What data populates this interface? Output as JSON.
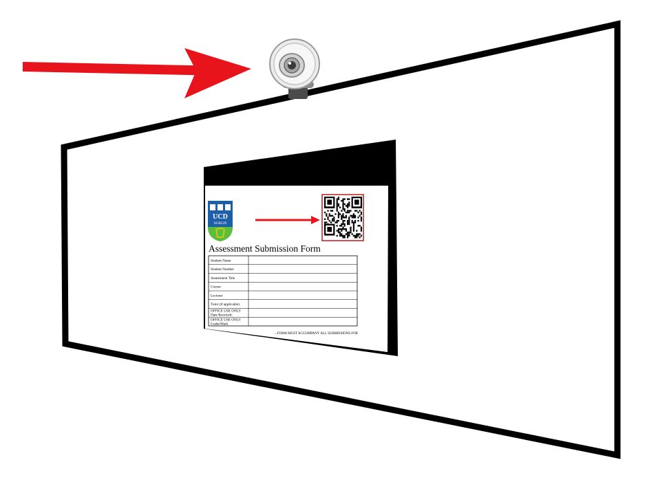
{
  "colors": {
    "arrow": "#e8141b",
    "frame": "#000000",
    "background": "#ffffff",
    "crest_blue": "#1d5fa8",
    "crest_green": "#5bbf3a",
    "crest_yellow": "#f1c21b",
    "qr_border": "#c0171c"
  },
  "icons": {
    "webcam": "webcam-icon",
    "qr": "qr-code-icon",
    "crest": "ucd-crest-logo"
  },
  "form": {
    "logo_text": "UCD",
    "logo_subtext": "DUBLIN",
    "title": "Assessment Submission Form",
    "rows": [
      "Student Name",
      "Student Number",
      "Assessment Title",
      "Course",
      "Lecturer",
      "Tutor (if applicable)",
      "OFFICE USE ONLY Date Received:",
      "OFFICE USE ONLY Grade/Mark"
    ],
    "footer": "...FORM MUST ACCOMPANY ALL SUBMISSIONS FOR"
  }
}
